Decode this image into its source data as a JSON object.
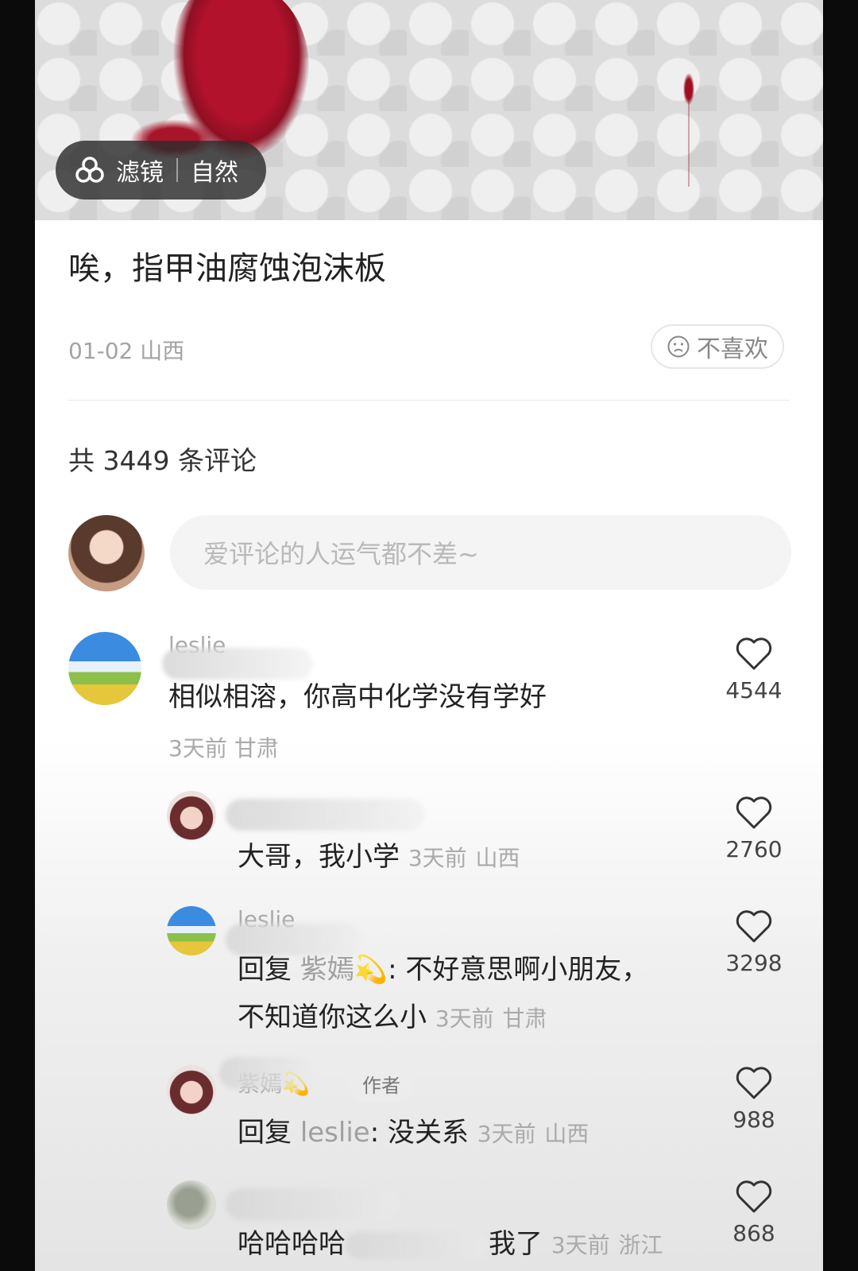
{
  "post": {
    "filter_label": "滤镜",
    "filter_value": "自然",
    "title": "唉，指甲油腐蚀泡沫板",
    "meta": "01-02 山西",
    "dislike_label": "不喜欢"
  },
  "comments_header": {
    "count_text": "共 3449 条评论",
    "input_placeholder": "爱评论的人运气都不差~"
  },
  "comments": [
    {
      "user": "leslie",
      "text": "相似相溶，你高中化学没有学好",
      "time": "3天前",
      "location": "甘肃",
      "likes": "4544"
    },
    {
      "user": "紫嫣💫",
      "badge": "作者",
      "text": "大哥，我小学",
      "time": "3天前",
      "location": "山西",
      "likes": "2760"
    },
    {
      "user": "leslie",
      "reply_prefix": "回复 ",
      "reply_to": "紫嫣💫",
      "text": ": 不好意思啊小朋友，",
      "text2": "不知道你这么小",
      "time": "3天前",
      "location": "甘肃",
      "likes": "3298"
    },
    {
      "user": "紫嫣💫",
      "badge": "作者",
      "reply_prefix": "回复 ",
      "reply_to": "leslie",
      "text": ": 没关系",
      "time": "3天前",
      "location": "山西",
      "likes": "988"
    },
    {
      "user": "",
      "text": "哈哈哈哈",
      "text_after": "我了",
      "time": "3天前",
      "location": "浙江",
      "likes": "868"
    }
  ],
  "colors": {
    "accent_red": "#b3122d",
    "muted": "#aaaaaa",
    "text": "#222222"
  }
}
